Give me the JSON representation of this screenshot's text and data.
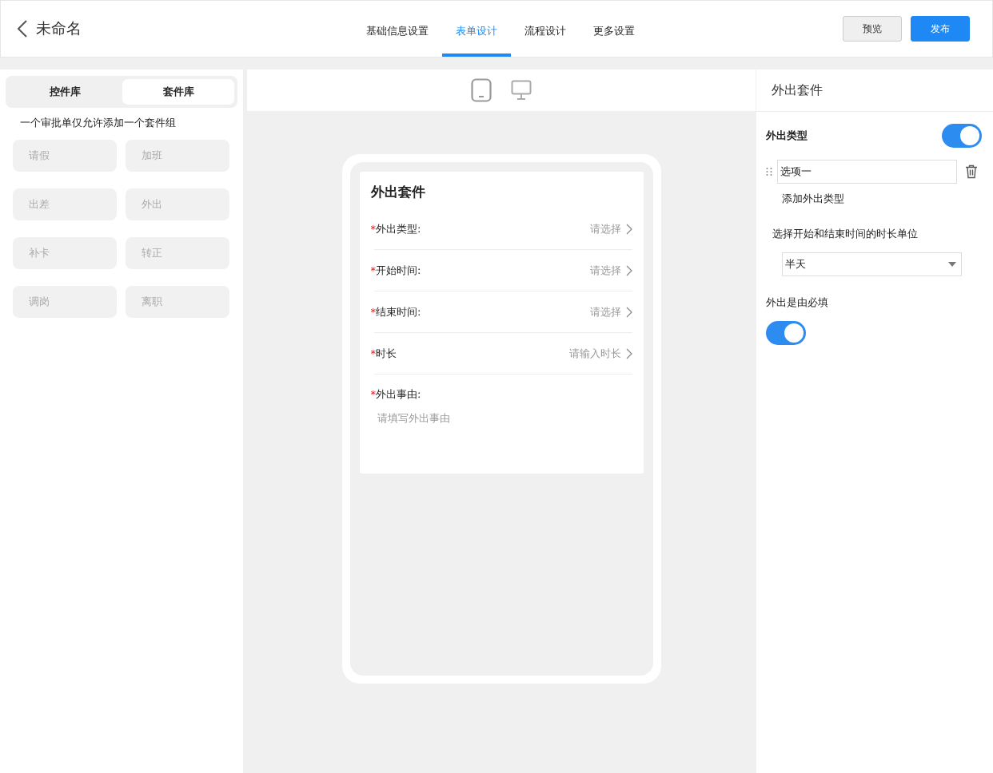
{
  "header": {
    "title": "未命名",
    "tabs": [
      {
        "label": "基础信息设置",
        "selected": false
      },
      {
        "label": "表单设计",
        "selected": true
      },
      {
        "label": "流程设计",
        "selected": false
      },
      {
        "label": "更多设置",
        "selected": false
      }
    ],
    "buttons": [
      {
        "label": "预览",
        "kind": "secondary"
      },
      {
        "label": "发布",
        "kind": "primary"
      }
    ]
  },
  "library": {
    "tabs": [
      {
        "label": "控件库",
        "selected": false
      },
      {
        "label": "套件库",
        "selected": true
      }
    ],
    "note": "一个审批单仅允许添加一个套件组",
    "items": [
      {
        "label": "请假",
        "disabled": true
      },
      {
        "label": "加班",
        "disabled": true
      },
      {
        "label": "出差",
        "disabled": true
      },
      {
        "label": "外出",
        "disabled": true
      },
      {
        "label": "补卡",
        "disabled": true
      },
      {
        "label": "转正",
        "disabled": true
      },
      {
        "label": "调岗",
        "disabled": true
      },
      {
        "label": "离职",
        "disabled": true
      }
    ]
  },
  "canvas": {
    "devices": [
      {
        "kind": "mobile",
        "selected": true
      },
      {
        "kind": "desktop",
        "selected": false
      }
    ],
    "form": {
      "title": "外出套件",
      "fields": [
        {
          "kind": "select",
          "mark": "*",
          "label": "外出类型:",
          "placeholder": "请选择"
        },
        {
          "kind": "select",
          "mark": "*",
          "label": "开始时间:",
          "placeholder": "请选择"
        },
        {
          "kind": "select",
          "mark": "*",
          "label": "结束时间:",
          "placeholder": "请选择"
        },
        {
          "kind": "select",
          "mark": "*",
          "label": "时长",
          "placeholder": "请输入时长"
        },
        {
          "kind": "textarea",
          "mark": "*",
          "label": "外出事由:",
          "placeholder": "请填写外出事由"
        }
      ]
    }
  },
  "properties": {
    "title": "外出套件",
    "type_label": "外出类型",
    "type_switch": {
      "on": true
    },
    "options": [
      {
        "value": "选项一"
      }
    ],
    "add_option": "添加外出类型",
    "unit_label": "选择开始和结束时间的时长单位",
    "unit_value": "半天",
    "reason_label": "外出是由必填",
    "reason_switch": {
      "on": true
    }
  }
}
